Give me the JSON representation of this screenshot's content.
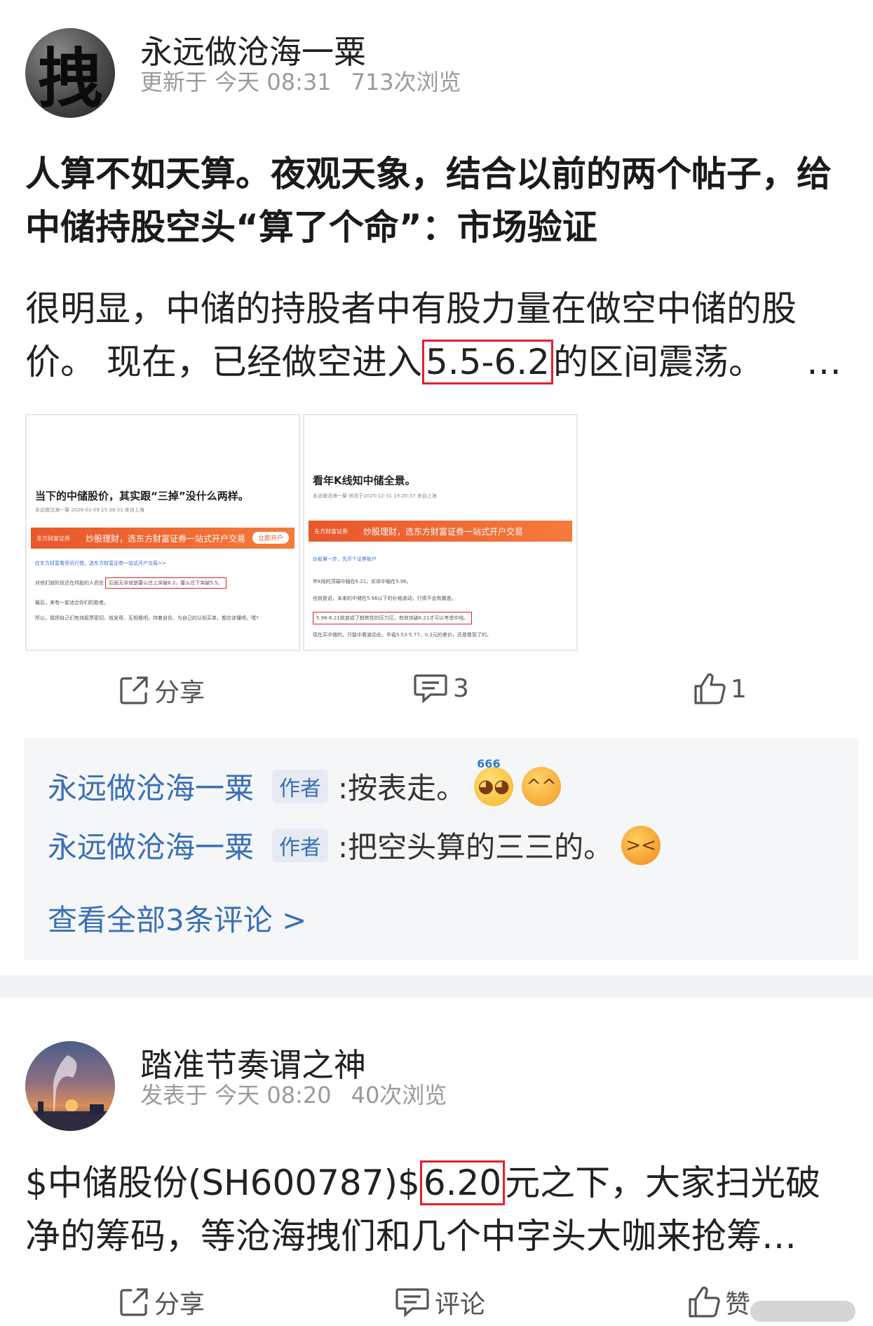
{
  "post1": {
    "author": "永远做沧海一粟",
    "avatar_char": "拽",
    "updated": "更新于 今天 08:31",
    "views": "713次浏览",
    "title": "人算不如天算。夜观天象，结合以前的两个帖子，给中储持股空头“算了个命”：市场验证",
    "body_line1": "很明显，中储的持股者中有股力量在做空中储的股",
    "body_line2_pre": "价。 现在，已经做空进入",
    "body_highlight": "5.5-6.2",
    "body_line2_post": "的区间震荡。",
    "ellipsis": "…",
    "images": [
      {
        "title": "当下的中储股价，其实跟“三掉”没什么两样。",
        "meta": "永远做沧海一粟 2026-01-09 15:38:31 来自上海",
        "banner": "炒股理财，选东方财富证券一站式开户交易",
        "banner_badge": "东方财富证券",
        "cta": "立即开户",
        "link": "在东方财富看资讯行情，选东方财富证券一站式开户交易>>",
        "line1_pre": "对他们就阶段还在持股的人而言",
        "line1_box": "后面无非就是要么往上突破6.2，要么往下突破5.5。",
        "line2": "最后，来有一套适合你们的股者。",
        "line3": "所以，我把自己们有持股票密切、就发帮、互相看吧。持着自负、为自己的认知买单，都应该懂吧。嘿?"
      },
      {
        "title": "看年K线知中储全景。",
        "meta": "永远做沧海一粟 修改于2025-12-31 19:20:37 来自上海",
        "banner": "炒股理财，选东方财富证券一站式开户交易",
        "banner_badge": "东方财富证券",
        "link": "炒股第一步，先开个证券账户",
        "line1": "年K线的顶端中轴在6.21，实体中轴在5.96。",
        "line2": "也就是说，未来的中储在5.96以下的价格波动，行情不会有赢度。",
        "line3_box": "5.96-6.21就变成了趋势性的压力区，有效突破6.21才可以考虑中线。",
        "line4": "现在买中储的，只能中看波动去。毕竟5.53-5.77、0.2元的差价，还是看到了的。"
      }
    ],
    "actions": {
      "share": "分享",
      "comments": "3",
      "likes": "1"
    },
    "comments": [
      {
        "name": "永远做沧海一粟",
        "tag": "作者",
        "text": ":按表走。"
      },
      {
        "name": "永远做沧海一粟",
        "tag": "作者",
        "text": ":把空头算的三三的。"
      }
    ],
    "emoji_666": "666",
    "view_all": "查看全部3条评论 >"
  },
  "post2": {
    "author": "踏准节奏谓之神",
    "published": "发表于 今天 08:20",
    "views": "40次浏览",
    "body_line1_pre": "$中储股份(SH600787)$",
    "body_highlight": "6.20",
    "body_line1_post": "元之下，大家扫光破",
    "body_line2": "净的筹码，等沧海拽们和几个中字头大咖来抢筹…",
    "actions": {
      "share": "分享",
      "comment": "评论",
      "like": "赞"
    }
  },
  "colors": {
    "link_blue": "#3a6fb6",
    "highlight_red": "#e5202e",
    "banner_orange": "#e9572c"
  }
}
